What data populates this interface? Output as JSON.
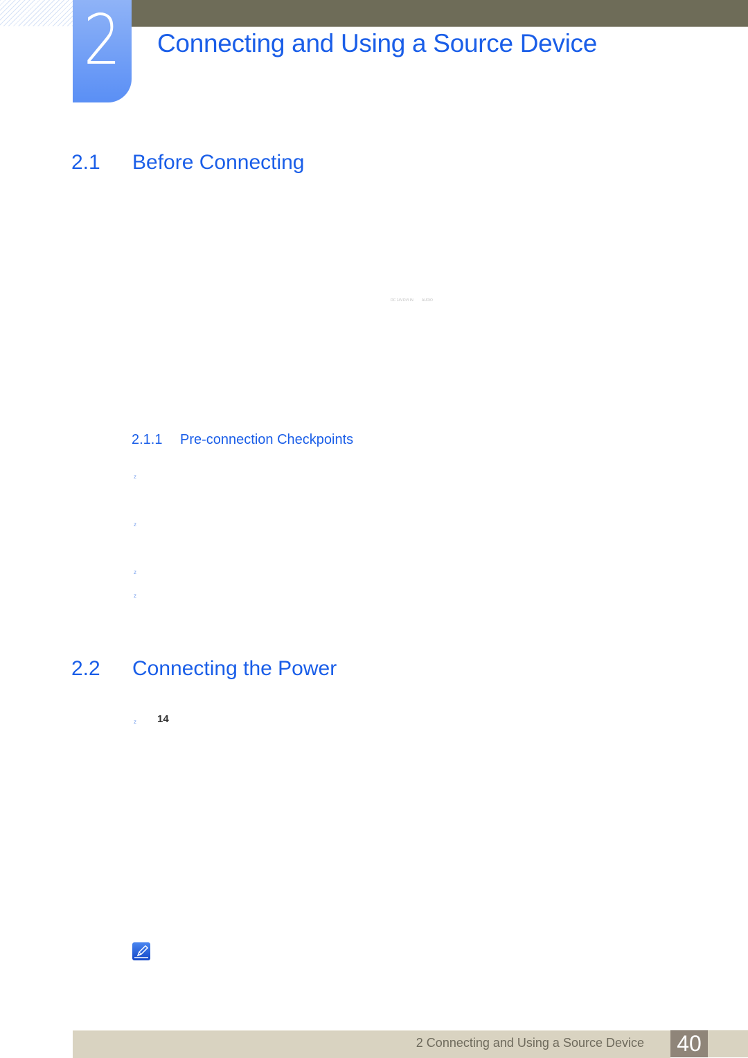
{
  "chapter": {
    "number": "2",
    "title": "Connecting and Using a Source Device"
  },
  "sections": [
    {
      "number": "2.1",
      "title": "Before Connecting"
    },
    {
      "number": "2.2",
      "title": "Connecting the Power"
    }
  ],
  "subsections": [
    {
      "number": "2.1.1",
      "title": "Pre-connection Checkpoints"
    }
  ],
  "faint_labels": [
    "DC 14V",
    "DVI IN",
    "AUDIO"
  ],
  "bullets": [
    "z",
    "z",
    "z",
    "z",
    "z"
  ],
  "power_item_number": "14",
  "icons": {
    "note": "note-pencil-icon"
  },
  "footer": {
    "chapter_label": "2 Connecting and Using a Source Device",
    "page_number": "40"
  }
}
